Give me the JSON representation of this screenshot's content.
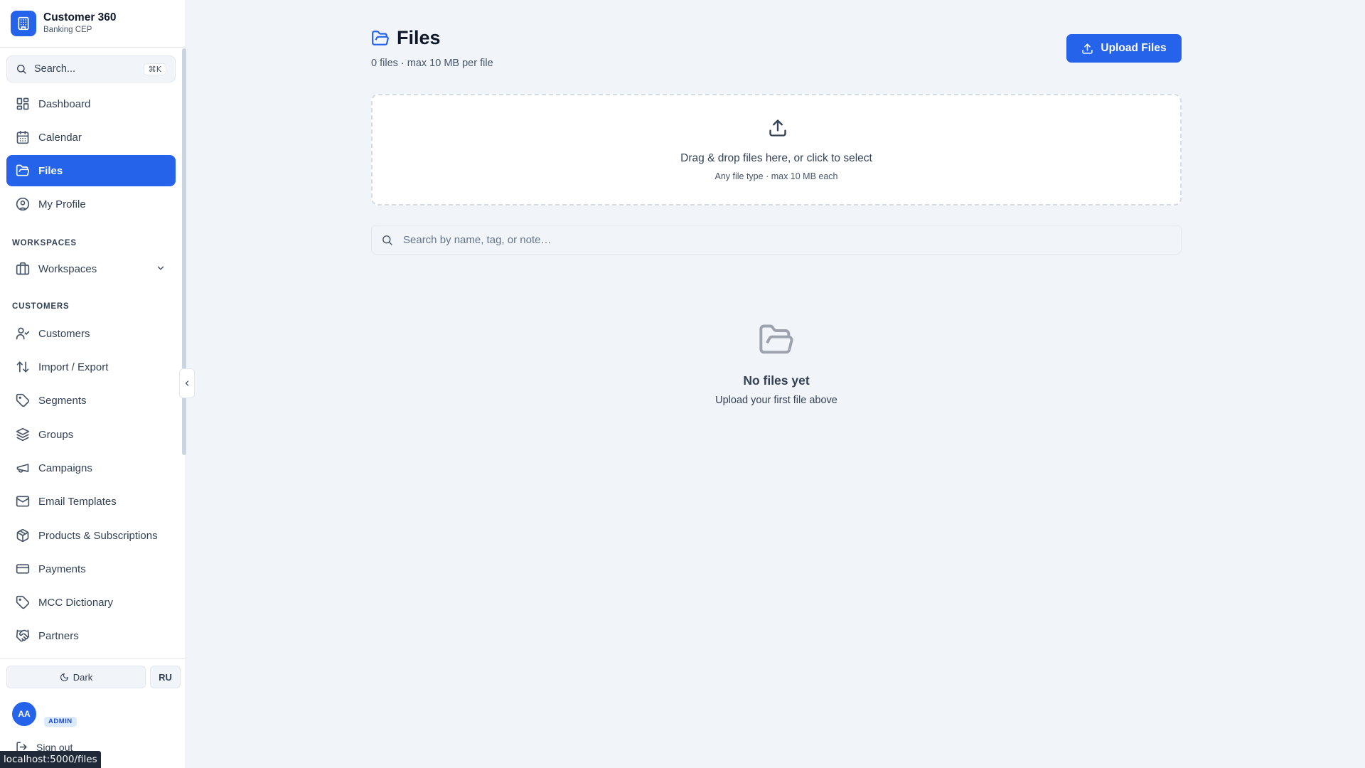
{
  "brand": {
    "name": "Customer 360",
    "subtitle": "Banking CEP"
  },
  "sidebar": {
    "search": {
      "placeholder": "Search...",
      "shortcut": "⌘K"
    },
    "primary_nav": [
      {
        "label": "Dashboard",
        "icon": "dashboard-icon"
      },
      {
        "label": "Calendar",
        "icon": "calendar-icon"
      },
      {
        "label": "Files",
        "icon": "folder-open-icon",
        "active": true
      },
      {
        "label": "My Profile",
        "icon": "user-circle-icon"
      }
    ],
    "workspaces_section": {
      "title": "WORKSPACES",
      "items": [
        {
          "label": "Workspaces",
          "icon": "briefcase-icon",
          "expandable": true
        }
      ]
    },
    "customers_section": {
      "title": "CUSTOMERS",
      "items": [
        {
          "label": "Customers",
          "icon": "user-check-icon"
        },
        {
          "label": "Import / Export",
          "icon": "arrows-up-down-icon"
        },
        {
          "label": "Segments",
          "icon": "tag-icon"
        },
        {
          "label": "Groups",
          "icon": "layers-icon"
        },
        {
          "label": "Campaigns",
          "icon": "megaphone-icon"
        },
        {
          "label": "Email Templates",
          "icon": "mail-icon"
        },
        {
          "label": "Products & Subscriptions",
          "icon": "package-icon"
        },
        {
          "label": "Payments",
          "icon": "credit-card-icon"
        },
        {
          "label": "MCC Dictionary",
          "icon": "tag-icon"
        },
        {
          "label": "Partners",
          "icon": "handshake-icon"
        }
      ]
    },
    "footer": {
      "theme_label": "Dark",
      "language_label": "RU",
      "avatar_initials": "AA",
      "role_badge": "ADMIN",
      "signout_label": "Sign out"
    }
  },
  "main": {
    "title": "Files",
    "subtitle": "0 files · max 10 MB per file",
    "upload_button": "Upload Files",
    "dropzone": {
      "main_text": "Drag & drop files here, or click to select",
      "sub_text": "Any file type · max 10 MB each"
    },
    "search": {
      "placeholder": "Search by name, tag, or note…"
    },
    "empty_state": {
      "title": "No files yet",
      "subtitle": "Upload your first file above"
    }
  },
  "status_bar": {
    "url": "localhost:5000/files"
  },
  "colors": {
    "accent": "#2563eb",
    "background": "#f1f4f8",
    "sidebar": "#ffffff",
    "text": "#0f172a"
  }
}
